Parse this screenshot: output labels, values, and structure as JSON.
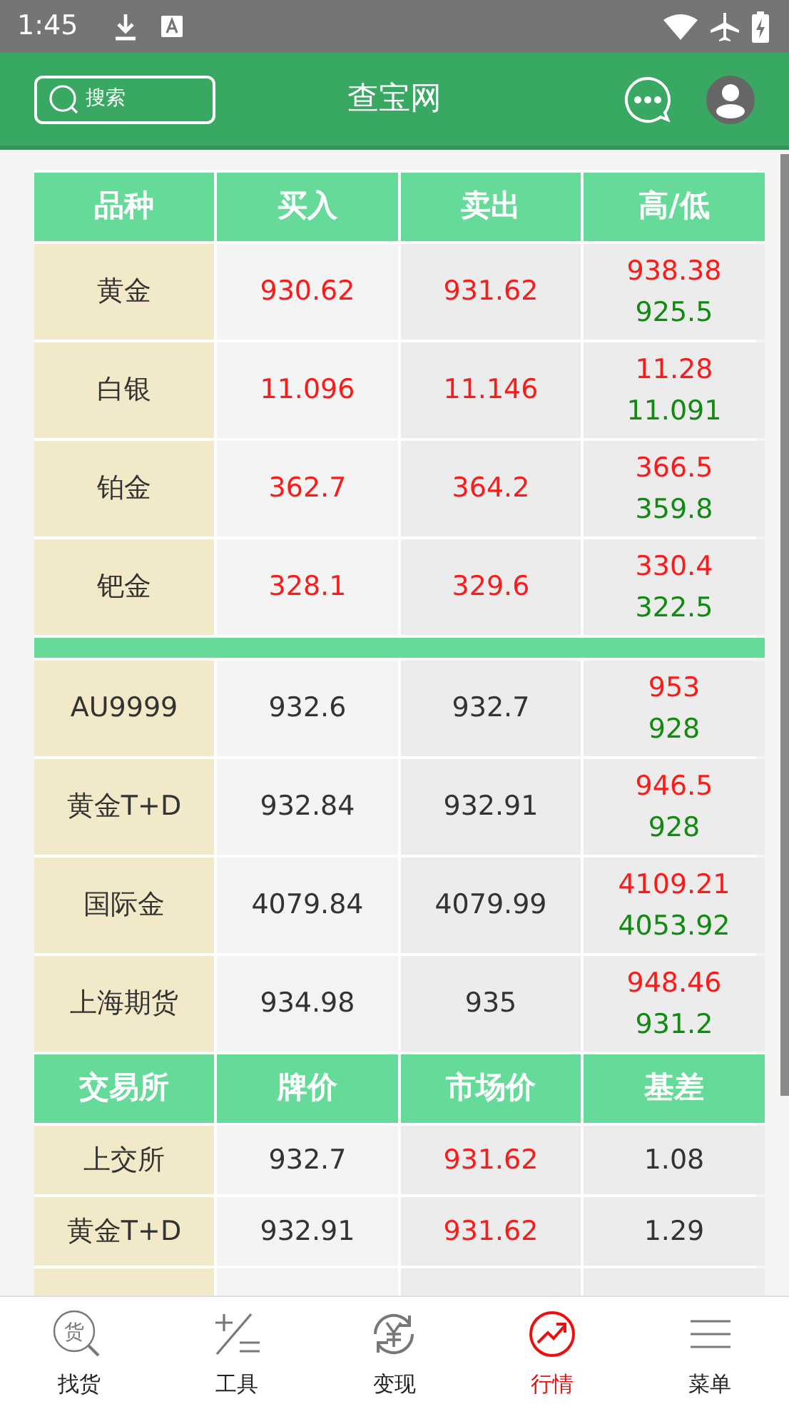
{
  "status_bar": {
    "time": "1:45"
  },
  "header": {
    "search_label": "搜索",
    "title": "查宝网"
  },
  "price_table": {
    "columns": [
      "品种",
      "买入",
      "卖出",
      "高/低"
    ],
    "sections": [
      {
        "rows": [
          {
            "name": "黄金",
            "buy": {
              "text": "930.62",
              "kind": "up"
            },
            "sell": {
              "text": "931.62",
              "kind": "up"
            },
            "high": "938.38",
            "low": "925.5"
          },
          {
            "name": "白银",
            "buy": {
              "text": "11.096",
              "kind": "up"
            },
            "sell": {
              "text": "11.146",
              "kind": "up"
            },
            "high": "11.28",
            "low": "11.091"
          },
          {
            "name": "铂金",
            "buy": {
              "text": "362.7",
              "kind": "up"
            },
            "sell": {
              "text": "364.2",
              "kind": "up"
            },
            "high": "366.5",
            "low": "359.8"
          },
          {
            "name": "钯金",
            "buy": {
              "text": "328.1",
              "kind": "up"
            },
            "sell": {
              "text": "329.6",
              "kind": "up"
            },
            "high": "330.4",
            "low": "322.5"
          }
        ]
      },
      {
        "rows": [
          {
            "name": "AU9999",
            "buy": {
              "text": "932.6",
              "kind": "plain"
            },
            "sell": {
              "text": "932.7",
              "kind": "plain"
            },
            "high": "953",
            "low": "928"
          },
          {
            "name": "黄金T+D",
            "buy": {
              "text": "932.84",
              "kind": "plain"
            },
            "sell": {
              "text": "932.91",
              "kind": "plain"
            },
            "high": "946.5",
            "low": "928"
          },
          {
            "name": "国际金",
            "buy": {
              "text": "4079.84",
              "kind": "plain"
            },
            "sell": {
              "text": "4079.99",
              "kind": "plain"
            },
            "high": "4109.21",
            "low": "4053.92"
          },
          {
            "name": "上海期货",
            "buy": {
              "text": "934.98",
              "kind": "plain"
            },
            "sell": {
              "text": "935",
              "kind": "plain"
            },
            "high": "948.46",
            "low": "931.2"
          }
        ]
      }
    ]
  },
  "basis_table": {
    "columns": [
      "交易所",
      "牌价",
      "市场价",
      "基差"
    ],
    "rows": [
      {
        "exchange": "上交所",
        "list_price": "932.7",
        "market_price": "931.62",
        "basis": "1.08"
      },
      {
        "exchange": "黄金T+D",
        "list_price": "932.91",
        "market_price": "931.62",
        "basis": "1.29"
      }
    ]
  },
  "bottom_nav": [
    {
      "label": "找货",
      "kind": "find",
      "icon_text": "货",
      "selected": false
    },
    {
      "label": "工具",
      "kind": "tools",
      "selected": false
    },
    {
      "label": "变现",
      "kind": "exchange",
      "selected": false
    },
    {
      "label": "行情",
      "kind": "trend",
      "selected": true
    },
    {
      "label": "菜单",
      "kind": "menu",
      "selected": false
    }
  ]
}
